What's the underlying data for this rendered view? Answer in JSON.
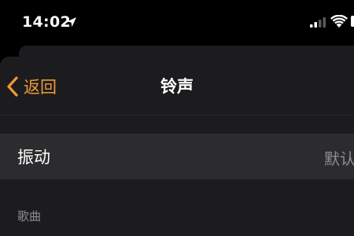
{
  "status_bar": {
    "time": "14:02",
    "icons": [
      "location-arrow-icon",
      "cellular-signal-icon",
      "wifi-icon",
      "battery-icon"
    ]
  },
  "nav": {
    "back_label": "返回",
    "title": "铃声"
  },
  "vibration_row": {
    "label": "振动",
    "value": "默认"
  },
  "section": {
    "header": "歌曲"
  },
  "colors": {
    "accent": "#f09a37",
    "background": "#000000",
    "sheet": "#1c1c1e",
    "cell": "#2c2c2e",
    "secondary_text": "#8e8e93"
  }
}
